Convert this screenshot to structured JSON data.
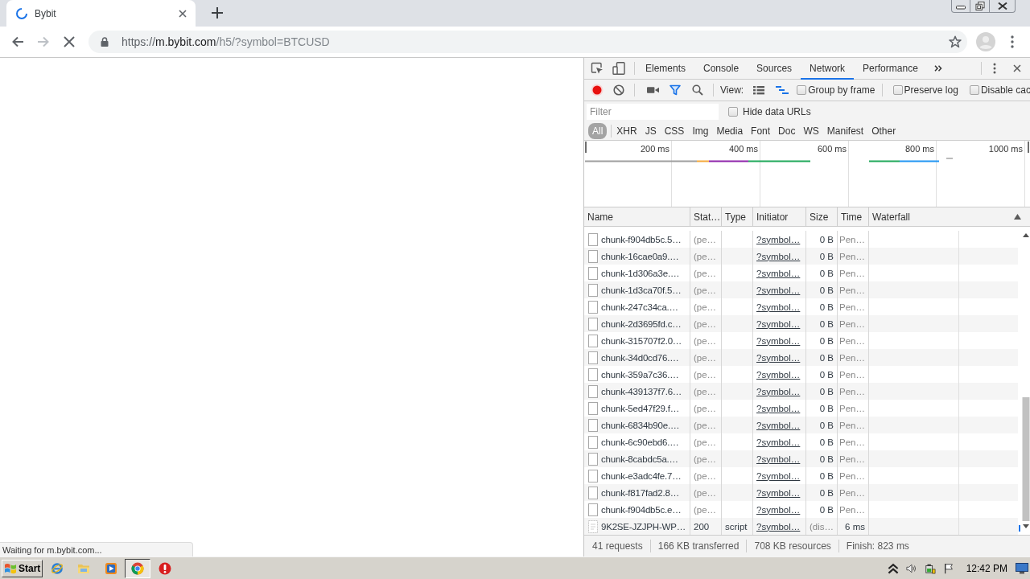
{
  "browser": {
    "tabs": [
      {
        "title": "Bybit",
        "loading": true,
        "selected": true
      }
    ],
    "toolbar": {
      "back_disabled": false,
      "forward_disabled": true,
      "loading": true,
      "address": {
        "scheme": "https://",
        "host": "m.bybit.com",
        "path": "/h5/?symbol=BTCUSD"
      },
      "bookmarked": false
    },
    "status": "Waiting for m.bybit.com..."
  },
  "devtools": {
    "tabs": [
      {
        "label": "Elements",
        "selected": false
      },
      {
        "label": "Console",
        "selected": false
      },
      {
        "label": "Sources",
        "selected": false
      },
      {
        "label": "Network",
        "selected": true
      },
      {
        "label": "Performance",
        "selected": false
      }
    ],
    "toolbar": {
      "recording": true,
      "filter_active": true,
      "view_label": "View:",
      "large_rows": false,
      "show_overview": true,
      "options": [
        {
          "label": "Group by frame",
          "checked": false
        },
        {
          "label": "Preserve log",
          "checked": false
        },
        {
          "label": "Disable cac",
          "checked": false
        }
      ]
    },
    "filter": {
      "placeholder": "Filter",
      "hide_data_urls": {
        "label": "Hide data URLs",
        "checked": false
      }
    },
    "types": [
      {
        "label": "All",
        "selected": true
      },
      {
        "label": "XHR",
        "selected": false
      },
      {
        "label": "JS",
        "selected": false
      },
      {
        "label": "CSS",
        "selected": false
      },
      {
        "label": "Img",
        "selected": false
      },
      {
        "label": "Media",
        "selected": false
      },
      {
        "label": "Font",
        "selected": false
      },
      {
        "label": "Doc",
        "selected": false
      },
      {
        "label": "WS",
        "selected": false
      },
      {
        "label": "Manifest",
        "selected": false
      },
      {
        "label": "Other",
        "selected": false
      }
    ],
    "overview": {
      "ticks": [
        "200 ms",
        "400 ms",
        "600 ms",
        "800 ms",
        "1000 ms"
      ]
    },
    "columns": [
      {
        "label": "Name",
        "sorted": false
      },
      {
        "label": "Stat…",
        "sorted": false
      },
      {
        "label": "Type",
        "sorted": false
      },
      {
        "label": "Initiator",
        "sorted": false
      },
      {
        "label": "Size",
        "sorted": false
      },
      {
        "label": "Time",
        "sorted": false
      },
      {
        "label": "Waterfall",
        "sorted": true
      }
    ],
    "requests": [
      {
        "name": "chunk-f904db5c.5…",
        "status": "(pe…",
        "initiator": "?symbol…",
        "size": "0 B",
        "time": "Pen…",
        "pending": true
      },
      {
        "name": "chunk-16cae0a9.…",
        "status": "(pe…",
        "initiator": "?symbol…",
        "size": "0 B",
        "time": "Pen…",
        "pending": true
      },
      {
        "name": "chunk-1d306a3e.…",
        "status": "(pe…",
        "initiator": "?symbol…",
        "size": "0 B",
        "time": "Pen…",
        "pending": true
      },
      {
        "name": "chunk-1d3ca70f.5…",
        "status": "(pe…",
        "initiator": "?symbol…",
        "size": "0 B",
        "time": "Pen…",
        "pending": true
      },
      {
        "name": "chunk-247c34ca.…",
        "status": "(pe…",
        "initiator": "?symbol…",
        "size": "0 B",
        "time": "Pen…",
        "pending": true
      },
      {
        "name": "chunk-2d3695fd.c…",
        "status": "(pe…",
        "initiator": "?symbol…",
        "size": "0 B",
        "time": "Pen…",
        "pending": true
      },
      {
        "name": "chunk-315707f2.0…",
        "status": "(pe…",
        "initiator": "?symbol…",
        "size": "0 B",
        "time": "Pen…",
        "pending": true
      },
      {
        "name": "chunk-34d0cd76.…",
        "status": "(pe…",
        "initiator": "?symbol…",
        "size": "0 B",
        "time": "Pen…",
        "pending": true
      },
      {
        "name": "chunk-359a7c36.…",
        "status": "(pe…",
        "initiator": "?symbol…",
        "size": "0 B",
        "time": "Pen…",
        "pending": true
      },
      {
        "name": "chunk-439137f7.6…",
        "status": "(pe…",
        "initiator": "?symbol…",
        "size": "0 B",
        "time": "Pen…",
        "pending": true
      },
      {
        "name": "chunk-5ed47f29.f…",
        "status": "(pe…",
        "initiator": "?symbol…",
        "size": "0 B",
        "time": "Pen…",
        "pending": true
      },
      {
        "name": "chunk-6834b90e.…",
        "status": "(pe…",
        "initiator": "?symbol…",
        "size": "0 B",
        "time": "Pen…",
        "pending": true
      },
      {
        "name": "chunk-6c90ebd6.…",
        "status": "(pe…",
        "initiator": "?symbol…",
        "size": "0 B",
        "time": "Pen…",
        "pending": true
      },
      {
        "name": "chunk-8cabdc5a.…",
        "status": "(pe…",
        "initiator": "?symbol…",
        "size": "0 B",
        "time": "Pen…",
        "pending": true
      },
      {
        "name": "chunk-e3adc4fe.7…",
        "status": "(pe…",
        "initiator": "?symbol…",
        "size": "0 B",
        "time": "Pen…",
        "pending": true
      },
      {
        "name": "chunk-f817fad2.8…",
        "status": "(pe…",
        "initiator": "?symbol…",
        "size": "0 B",
        "time": "Pen…",
        "pending": true
      },
      {
        "name": "chunk-f904db5c.e…",
        "status": "(pe…",
        "initiator": "?symbol…",
        "size": "0 B",
        "time": "Pen…",
        "pending": true
      },
      {
        "name": "9K2SE-JZJPH-WP…",
        "status": "200",
        "type": "script",
        "initiator": "?symbol…",
        "size": "(dis…",
        "time": "6 ms",
        "pending": false
      }
    ],
    "summary": [
      "41 requests",
      "166 KB transferred",
      "708 KB resources",
      "Finish: 823 ms"
    ]
  },
  "taskbar": {
    "start": "Start",
    "apps": [
      {
        "selected": false
      },
      {
        "selected": false
      },
      {
        "selected": false
      },
      {
        "selected": true
      },
      {
        "selected": false
      }
    ],
    "clock": "12:42 PM"
  }
}
